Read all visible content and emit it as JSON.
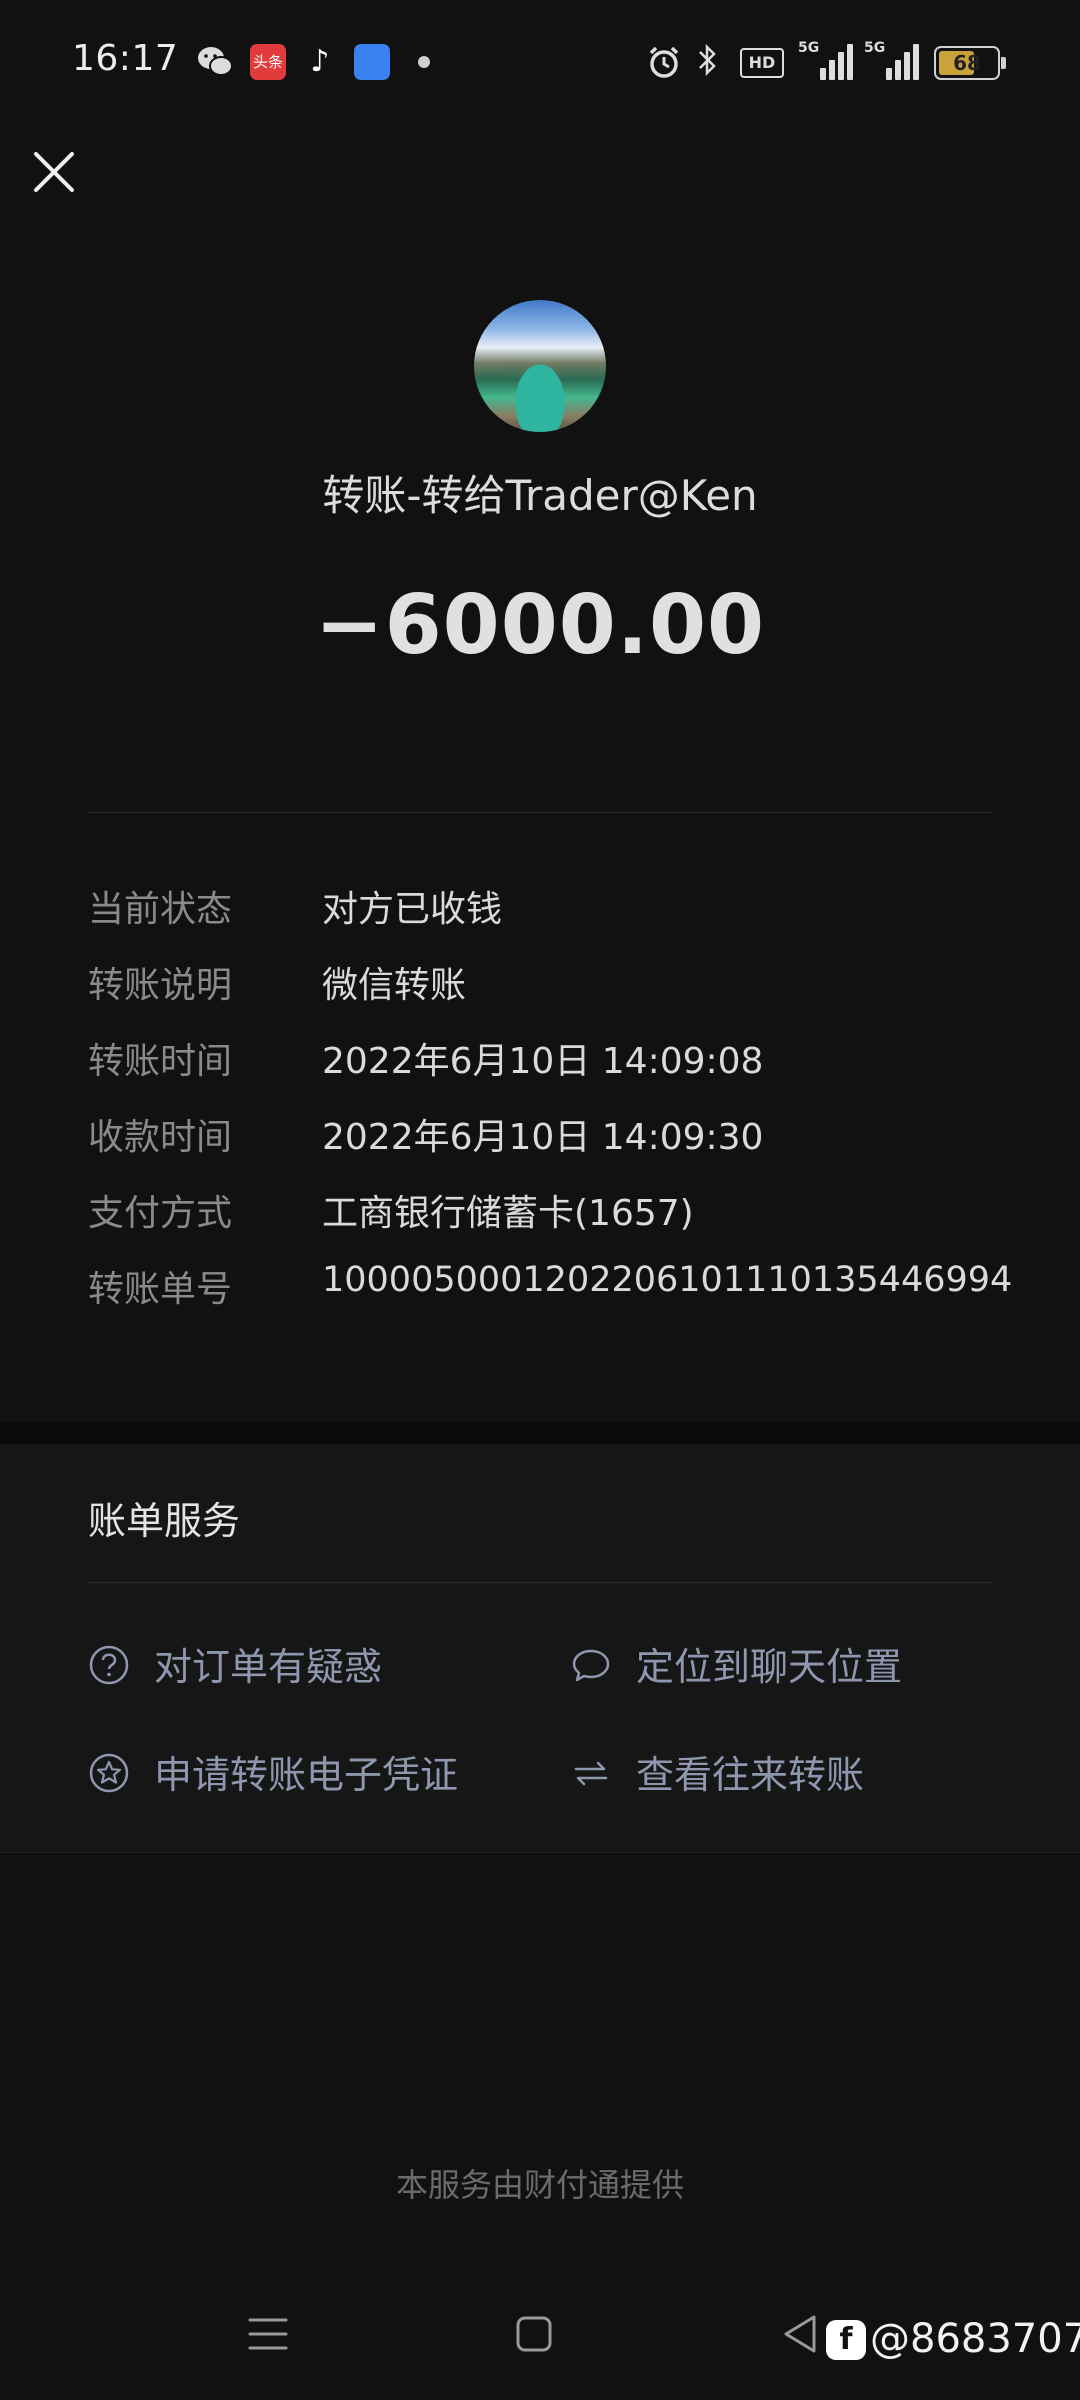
{
  "status_bar": {
    "time": "16:17",
    "toutiao_label": "头条",
    "signal_1_tag": "5G",
    "signal_2_tag": "5G",
    "hd_label": "HD",
    "battery_level": 68,
    "battery_text": "68",
    "icons": [
      "wechat-icon",
      "toutiao-icon",
      "tiktok-icon",
      "blue-app-icon",
      "dot-icon",
      "alarm-icon",
      "bluetooth-icon",
      "hd-icon",
      "signal-icon",
      "signal-icon",
      "battery-icon"
    ]
  },
  "header": {
    "close_icon": "close-icon",
    "title": "转账-转给Trader@Ken",
    "amount": "−6000.00"
  },
  "details": [
    {
      "label": "当前状态",
      "value": "对方已收钱"
    },
    {
      "label": "转账说明",
      "value": "微信转账"
    },
    {
      "label": "转账时间",
      "value": "2022年6月10日 14:09:08"
    },
    {
      "label": "收款时间",
      "value": "2022年6月10日 14:09:30"
    },
    {
      "label": "支付方式",
      "value": "工商银行储蓄卡(1657)"
    },
    {
      "label": "转账单号",
      "value": "100005000120220610111013544699­4"
    }
  ],
  "services": {
    "title": "账单服务",
    "items": [
      {
        "label": "对订单有疑惑",
        "icon": "question-icon"
      },
      {
        "label": "定位到聊天位置",
        "icon": "chat-bubble-icon"
      },
      {
        "label": "申请转账电子凭证",
        "icon": "star-badge-icon"
      },
      {
        "label": "查看往来转账",
        "icon": "swap-arrows-icon"
      }
    ]
  },
  "footer": {
    "note": "本服务由财付通提供"
  },
  "nav": {
    "icons": [
      "menu-icon",
      "home-square-icon",
      "back-triangle-icon"
    ]
  },
  "watermark": {
    "logo_letter": "f",
    "text": "@8683707"
  },
  "colors": {
    "background": "#111112",
    "panel": "#161617",
    "label_gray": "#8a8a8c",
    "service_text": "#8e97ad",
    "battery_fill": "#c9a23a"
  }
}
